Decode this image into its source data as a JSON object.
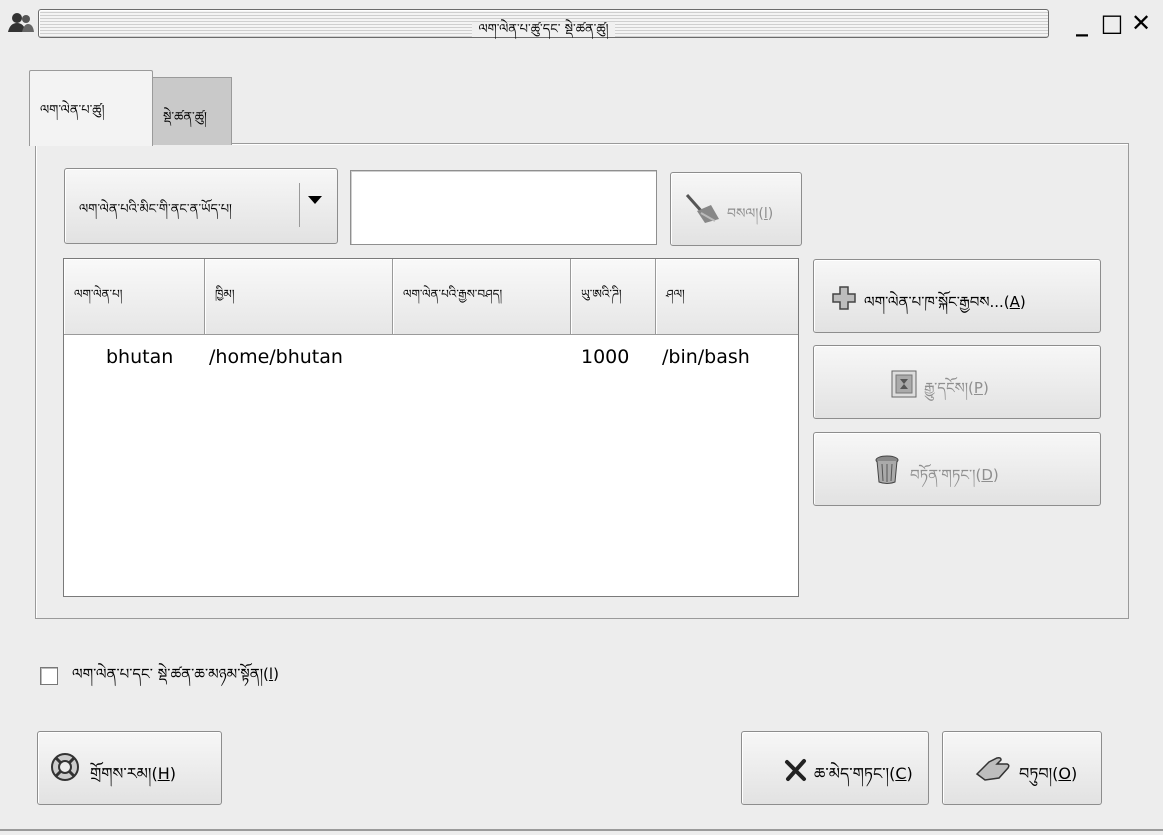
{
  "window": {
    "title": "ལག་ལེན་པ་ཚུ་དང་ སྡེ་ཚན་ཚུ།",
    "controls": {
      "minimize": "_",
      "maximize": "□",
      "close": "✕"
    }
  },
  "tabs": [
    {
      "label": "ལག་ལེན་པ་ཚུ།",
      "selected": true
    },
    {
      "label": "སྡེ་ཚན་ཚུ།",
      "selected": false
    }
  ],
  "filter": {
    "selected": "ལག་ལེན་པའི་མིང་གི་ནང་ན་ཡོད་པ།",
    "dropdown_icon": "triangle-down",
    "search_value": "",
    "clear_label": "བསལ།(",
    "clear_mnemonic": "l",
    "clear_suffix": ")"
  },
  "table": {
    "columns": [
      "ལག་ལེན་པ།",
      "ཁྱིམ།",
      "ལག་ལེན་པའི་རྒྱས་བཤད།",
      "ཡུ་ཨའི་ཌི།",
      "ཤལ།"
    ],
    "rows": [
      {
        "user": "bhutan",
        "home": "/home/bhutan",
        "fullname": "",
        "uid": "1000",
        "shell": "/bin/bash"
      }
    ]
  },
  "actions": {
    "add": {
      "text": "ལག་ལེན་པ་ཁ་སྐོང་རྒྱབས...(",
      "mnemonic": "A",
      "suffix": ")",
      "icon": "plus-icon",
      "enabled": true
    },
    "properties": {
      "text": "རྒྱུ་དངོས།(",
      "mnemonic": "P",
      "suffix": ")",
      "icon": "properties-icon",
      "enabled": false
    },
    "delete": {
      "text": "བཏོན་གཏང་།(",
      "mnemonic": "D",
      "suffix": ")",
      "icon": "trash-icon",
      "enabled": false
    }
  },
  "show_all": {
    "label": "ལག་ལེན་པ་དང་ སྡེ་ཚན་ཆ་མཉམ་སྟོན།(",
    "mnemonic": "l",
    "suffix": ")",
    "checked": false
  },
  "footer": {
    "help": {
      "text": "གྲོགས་རམ།(",
      "mnemonic": "H",
      "suffix": ")",
      "icon": "lifebuoy-icon"
    },
    "cancel": {
      "text": "ཆ་མེད་གཏང་།(",
      "mnemonic": "C",
      "suffix": ")",
      "icon": "x-icon"
    },
    "ok": {
      "text": "བཏུབ།(",
      "mnemonic": "O",
      "suffix": ")",
      "icon": "ok-hand-icon"
    }
  },
  "colors": {
    "window_bg": "#ededed",
    "disabled_text": "#8f8f8f",
    "list_bg": "#ffffff",
    "inactive_tab": "#c9c9c9"
  }
}
